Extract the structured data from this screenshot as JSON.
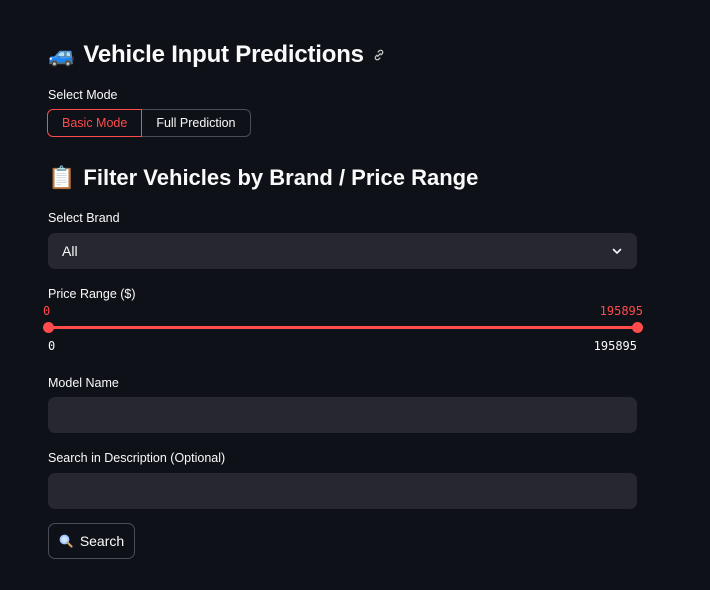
{
  "header": {
    "emoji": "🚙",
    "title": "Vehicle Input Predictions"
  },
  "mode": {
    "label": "Select Mode",
    "options": [
      "Basic Mode",
      "Full Prediction"
    ],
    "selected": "Basic Mode"
  },
  "filter": {
    "emoji": "📋",
    "heading": "Filter Vehicles by Brand / Price Range"
  },
  "brand": {
    "label": "Select Brand",
    "value": "All"
  },
  "price": {
    "label": "Price Range ($)",
    "low_value": "0",
    "high_value": "195895",
    "min_label": "0",
    "max_label": "195895",
    "range": [
      0,
      195895
    ],
    "selected": [
      0,
      195895
    ]
  },
  "model": {
    "label": "Model Name",
    "value": ""
  },
  "description": {
    "label": "Search in Description (Optional)",
    "value": ""
  },
  "search": {
    "label": "Search"
  },
  "colors": {
    "background": "#0e1117",
    "accent": "#ff4b4b",
    "input_bg": "#262730"
  }
}
